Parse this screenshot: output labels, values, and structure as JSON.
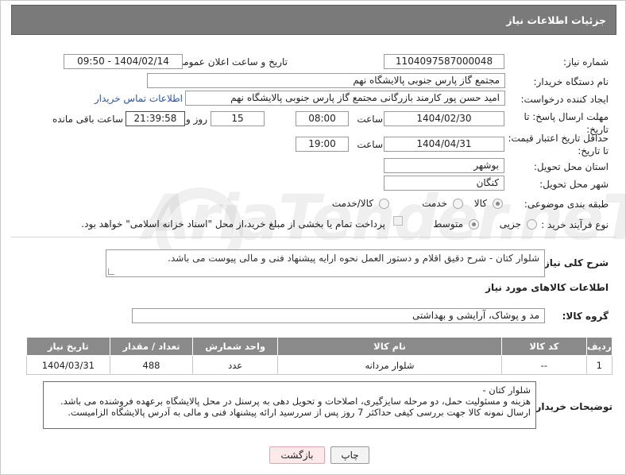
{
  "header": {
    "title": "جزئیات اطلاعات نیاز"
  },
  "form": {
    "need_number_label": "شماره نیاز:",
    "need_number": "1104097587000048",
    "announce_label": "تاریخ و ساعت اعلان عمومی:",
    "announce_value": "1404/02/14 - 09:50",
    "buyer_org_label": "نام دستگاه خریدار:",
    "buyer_org": "مجتمع گاز پارس جنوبی  پالایشگاه نهم",
    "creator_label": "ایجاد کننده درخواست:",
    "creator": "امید حسن پور کارمند بازرگانی مجتمع گاز پارس جنوبی  پالایشگاه نهم",
    "contact_link": "اطلاعات تماس خریدار",
    "deadline_label": "مهلت ارسال پاسخ: تا تاریخ:",
    "deadline_date": "1404/02/30",
    "time_label": "ساعت",
    "deadline_time": "08:00",
    "days_value": "15",
    "days_label": "روز و",
    "remaining_time": "21:39:58",
    "remaining_label": "ساعت باقی مانده",
    "validity_label": "حداقل تاریخ اعتبار قیمت: تا تاریخ:",
    "validity_date": "1404/04/31",
    "validity_time_label": "ساعت",
    "validity_time": "19:00",
    "province_label": "استان محل تحویل:",
    "province": "بوشهر",
    "city_label": "شهر محل تحویل:",
    "city": "کنگان",
    "category_label": "طبقه بندی موضوعی:",
    "category_options": [
      "کالا",
      "خدمت",
      "کالا/خدمت"
    ],
    "process_label": "نوع فرآیند خرید :",
    "process_options": [
      "جزیی",
      "متوسط"
    ],
    "payment_note": "پرداخت تمام یا بخشی از مبلغ خرید،از محل \"اسناد خزانه اسلامی\" خواهد بود.",
    "description_label": "شرح کلی نیاز:",
    "description": "شلوار کتان - شرح دقیق اقلام و دستور العمل نحوه ارایه پیشنهاد فنی و مالی پیوست می باشد.",
    "goods_info_title": "اطلاعات کالاهای مورد نیاز",
    "group_label": "گروه کالا:",
    "group_value": "مد و پوشاک، آرایشی و بهداشتی"
  },
  "table": {
    "headers": [
      "ردیف",
      "کد کالا",
      "نام کالا",
      "واحد شمارش",
      "تعداد / مقدار",
      "تاریخ نیاز"
    ],
    "rows": [
      [
        "1",
        "--",
        "شلوار مردانه",
        "عدد",
        "488",
        "1404/03/31"
      ]
    ]
  },
  "notes": {
    "label": "توضیحات خریدار:",
    "line1": "شلوار کتان -",
    "line2": "هزینه و مسئولیت حمل،  دو مرحله سایزگیری، اصلاحات و تحویل دهی به پرسنل در محل پالایشگاه برعهده فروشنده می باشد.",
    "line3": "ارسال نمونه کالا جهت بررسی کیفی حداکثر 7 روز پس از سررسید ارائه پیشنهاد فنی و مالی به آدرس پالایشگاه الزامیست."
  },
  "buttons": {
    "print": "چاپ",
    "back": "بازگشت"
  },
  "watermark": {
    "text": "AriaTender.neT"
  }
}
